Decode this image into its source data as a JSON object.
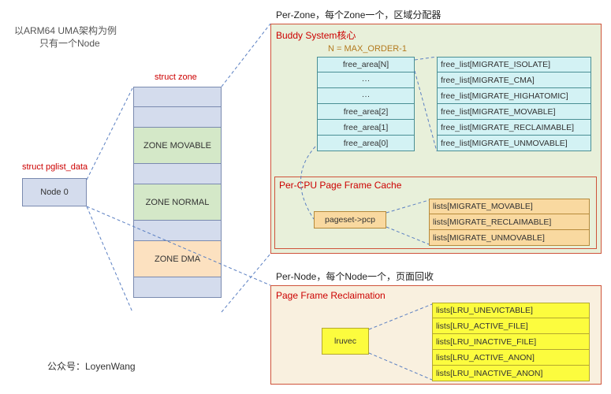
{
  "header": {
    "title_line1": "以ARM64 UMA架构为例",
    "title_line2": "只有一个Node",
    "pglist_label": "struct pglist_data",
    "zone_label": "struct zone"
  },
  "node": {
    "label": "Node 0"
  },
  "zones": [
    {
      "label": "",
      "cls": "zc-grey"
    },
    {
      "label": "",
      "cls": "zc-grey"
    },
    {
      "label": "ZONE MOVABLE",
      "cls": "zc-green zc-tall"
    },
    {
      "label": "",
      "cls": "zc-grey"
    },
    {
      "label": "ZONE NORMAL",
      "cls": "zc-green zc-tall"
    },
    {
      "label": "",
      "cls": "zc-grey"
    },
    {
      "label": "ZONE DMA",
      "cls": "zc-peach zc-tall"
    },
    {
      "label": "",
      "cls": "zc-grey"
    }
  ],
  "perzone_caption": "Per-Zone，每个Zone一个，区域分配器",
  "buddy": {
    "title": "Buddy System核心",
    "n_label": "N = MAX_ORDER-1",
    "free_area": [
      "free_area[N]",
      "···",
      "···",
      "free_area[2]",
      "free_area[1]",
      "free_area[0]"
    ],
    "free_list": [
      "free_list[MIGRATE_ISOLATE]",
      "free_list[MIGRATE_CMA]",
      "free_list[MIGRATE_HIGHATOMIC]",
      "free_list[MIGRATE_MOVABLE]",
      "free_list[MIGRATE_RECLAIMABLE]",
      "free_list[MIGRATE_UNMOVABLE]"
    ]
  },
  "pcpu": {
    "title": "Per-CPU Page Frame Cache",
    "pageset_label": "pageset->pcp",
    "lists": [
      "lists[MIGRATE_MOVABLE]",
      "lists[MIGRATE_RECLAIMABLE]",
      "lists[MIGRATE_UNMOVABLE]"
    ]
  },
  "pernode_caption": "Per-Node，每个Node一个，页面回收",
  "reclaim": {
    "title": "Page Frame Reclaimation",
    "lruvec_label": "lruvec",
    "lists": [
      "lists[LRU_UNEVICTABLE]",
      "lists[LRU_ACTIVE_FILE]",
      "lists[LRU_INACTIVE_FILE]",
      "lists[LRU_ACTIVE_ANON]",
      "lists[LRU_INACTIVE_ANON]"
    ]
  },
  "footer": {
    "credit": "公众号：LoyenWang"
  }
}
